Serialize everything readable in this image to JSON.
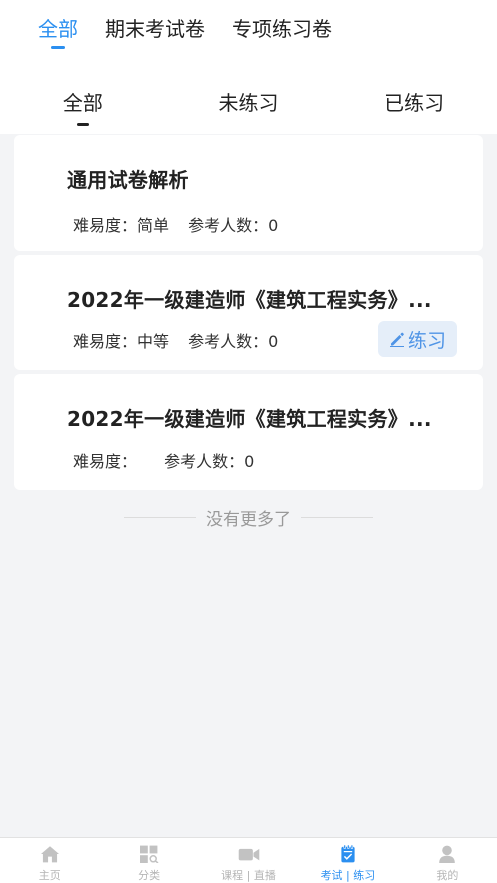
{
  "top_tabs": [
    {
      "label": "全部",
      "active": true
    },
    {
      "label": "期末考试卷",
      "active": false
    },
    {
      "label": "专项练习卷",
      "active": false
    }
  ],
  "sub_tabs": [
    {
      "label": "全部",
      "active": true
    },
    {
      "label": "未练习",
      "active": false
    },
    {
      "label": "已练习",
      "active": false
    }
  ],
  "papers": [
    {
      "title": "通用试卷解析",
      "difficulty_label": "难易度：",
      "difficulty": "简单",
      "participants_label": "参考人数：",
      "participants": "0"
    },
    {
      "title": "2022年一级建造师《建筑工程实务》...",
      "difficulty_label": "难易度：",
      "difficulty": "中等",
      "participants_label": "参考人数：",
      "participants": "0",
      "action_label": "练习",
      "action_icon": "pencil-icon"
    },
    {
      "title": "2022年一级建造师《建筑工程实务》...",
      "difficulty_label": "难易度：",
      "difficulty": "",
      "participants_label": "参考人数：",
      "participants": "0"
    }
  ],
  "list_footer": "没有更多了",
  "bottom_nav": [
    {
      "label": "主页",
      "icon": "home-icon"
    },
    {
      "label": "分类",
      "icon": "category-icon"
    },
    {
      "label": "课程 | 直播",
      "icon": "video-icon"
    },
    {
      "label": "考试 | 练习",
      "icon": "exam-icon",
      "active": true
    },
    {
      "label": "我的",
      "icon": "user-icon"
    }
  ],
  "colors": {
    "accent": "#2b8ff0",
    "background": "#f3f4f6",
    "practice_button_bg": "#e5eef9",
    "nav_inactive": "#b5b5b5"
  }
}
